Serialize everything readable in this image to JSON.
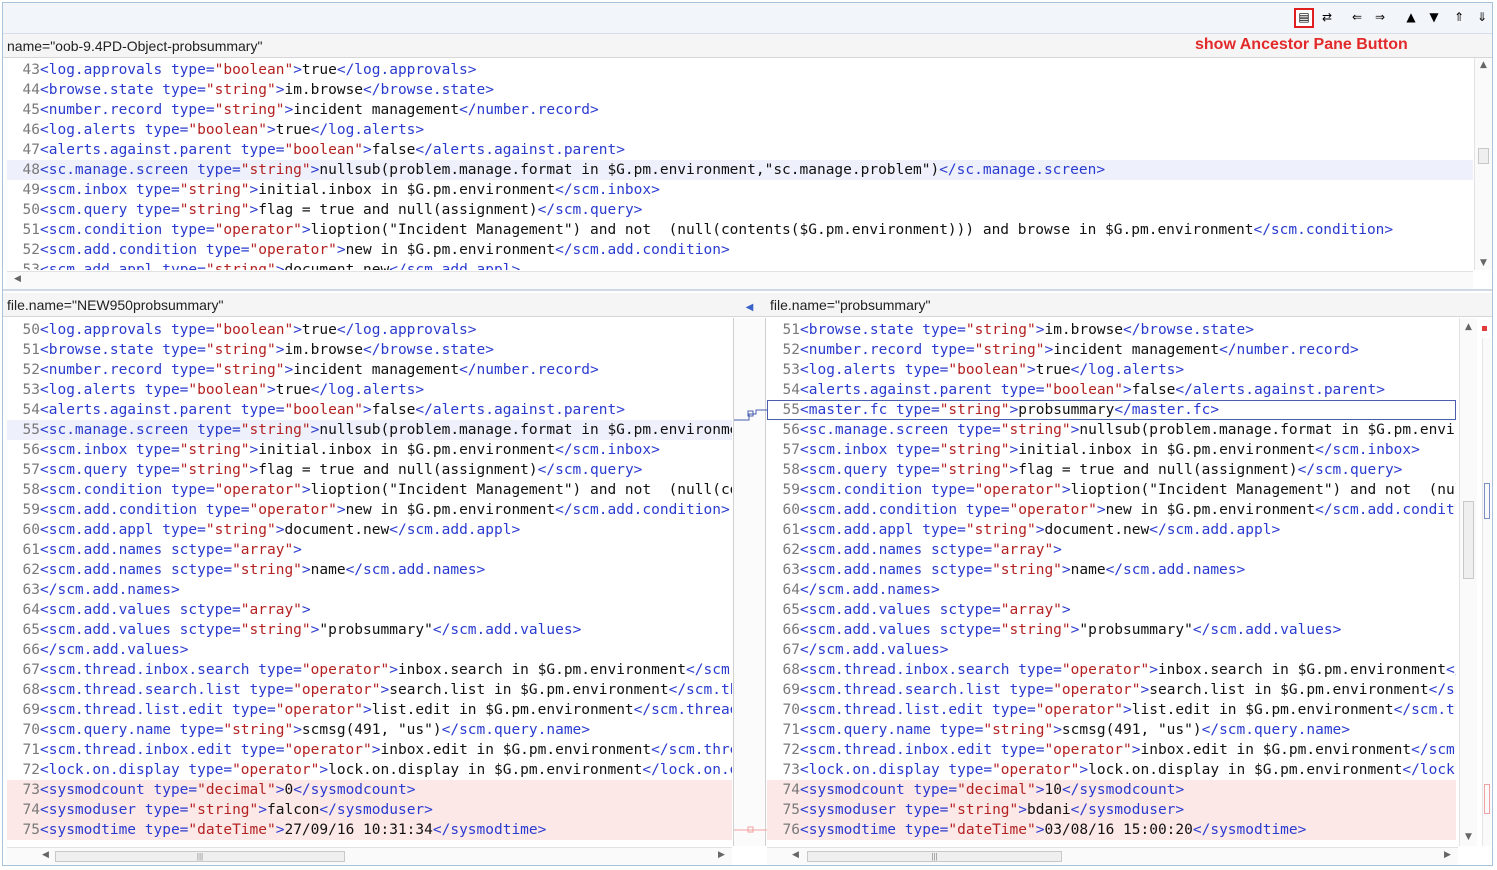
{
  "toolbar": {
    "buttons": [
      {
        "icon": "show-ancestor-pane-icon",
        "glyph": "▤"
      },
      {
        "icon": "swap-icon",
        "glyph": "⇄"
      },
      {
        "icon": "copy-left-icon",
        "glyph": "⇐"
      },
      {
        "icon": "copy-right-icon",
        "glyph": "⇒"
      },
      {
        "icon": "next-diff-icon",
        "glyph": "▲"
      },
      {
        "icon": "prev-diff-icon",
        "glyph": "▼"
      },
      {
        "icon": "next-change-icon",
        "glyph": "⇑"
      },
      {
        "icon": "prev-change-icon",
        "glyph": "⇓"
      }
    ]
  },
  "annotation": "show Ancestor Pane Button",
  "ancestor": {
    "name": "name=\"oob-9.4PD-Object-probsummary\"",
    "lines": [
      {
        "n": "43",
        "t": "<log.approvals type=\"boolean\">true</log.approvals>"
      },
      {
        "n": "44",
        "t": "<browse.state type=\"string\">im.browse</browse.state>"
      },
      {
        "n": "45",
        "t": "<number.record type=\"string\">incident management</number.record>"
      },
      {
        "n": "46",
        "t": "<log.alerts type=\"boolean\">true</log.alerts>"
      },
      {
        "n": "47",
        "t": "<alerts.against.parent type=\"boolean\">false</alerts.against.parent>"
      },
      {
        "n": "48",
        "t": "<sc.manage.screen type=\"string\">nullsub(problem.manage.format in $G.pm.environment,\"sc.manage.problem\")</sc.manage.screen>",
        "cls": "sel"
      },
      {
        "n": "49",
        "t": "<scm.inbox type=\"string\">initial.inbox in $G.pm.environment</scm.inbox>"
      },
      {
        "n": "50",
        "t": "<scm.query type=\"string\">flag = true and null(assignment)</scm.query>"
      },
      {
        "n": "51",
        "t": "<scm.condition type=\"operator\">lioption(\"Incident Management\") and not  (null(contents($G.pm.environment))) and browse in $G.pm.environment</scm.condition>"
      },
      {
        "n": "52",
        "t": "<scm.add.condition type=\"operator\">new in $G.pm.environment</scm.add.condition>"
      },
      {
        "n": "53",
        "t": "<scm.add.appl type=\"string\">document.new</scm.add.appl>"
      }
    ]
  },
  "left": {
    "name": "file.name=\"NEW950probsummary\"",
    "lines": [
      {
        "n": "50",
        "t": "<log.approvals type=\"boolean\">true</log.approvals>"
      },
      {
        "n": "51",
        "t": "<browse.state type=\"string\">im.browse</browse.state>"
      },
      {
        "n": "52",
        "t": "<number.record type=\"string\">incident management</number.record>"
      },
      {
        "n": "53",
        "t": "<log.alerts type=\"boolean\">true</log.alerts>"
      },
      {
        "n": "54",
        "t": "<alerts.against.parent type=\"boolean\">false</alerts.against.parent>"
      },
      {
        "n": "55",
        "t": "<sc.manage.screen type=\"string\">nullsub(problem.manage.format in $G.pm.environment,\"sc.manage.problem\")</sc.manage.screen>",
        "cls": "sel"
      },
      {
        "n": "56",
        "t": "<scm.inbox type=\"string\">initial.inbox in $G.pm.environment</scm.inbox>"
      },
      {
        "n": "57",
        "t": "<scm.query type=\"string\">flag = true and null(assignment)</scm.query>"
      },
      {
        "n": "58",
        "t": "<scm.condition type=\"operator\">lioption(\"Incident Management\") and not  (null(contents($G.pm.environment)))</scm.condition>"
      },
      {
        "n": "59",
        "t": "<scm.add.condition type=\"operator\">new in $G.pm.environment</scm.add.condition>"
      },
      {
        "n": "60",
        "t": "<scm.add.appl type=\"string\">document.new</scm.add.appl>"
      },
      {
        "n": "61",
        "t": "<scm.add.names sctype=\"array\">"
      },
      {
        "n": "62",
        "t": "<scm.add.names sctype=\"string\">name</scm.add.names>"
      },
      {
        "n": "63",
        "t": "</scm.add.names>"
      },
      {
        "n": "64",
        "t": "<scm.add.values sctype=\"array\">"
      },
      {
        "n": "65",
        "t": "<scm.add.values sctype=\"string\">\"probsummary\"</scm.add.values>"
      },
      {
        "n": "66",
        "t": "</scm.add.values>"
      },
      {
        "n": "67",
        "t": "<scm.thread.inbox.search type=\"operator\">inbox.search in $G.pm.environment</scm.thread.inbox.search>"
      },
      {
        "n": "68",
        "t": "<scm.thread.search.list type=\"operator\">search.list in $G.pm.environment</scm.thread.search.list>"
      },
      {
        "n": "69",
        "t": "<scm.thread.list.edit type=\"operator\">list.edit in $G.pm.environment</scm.thread.list.edit>"
      },
      {
        "n": "70",
        "t": "<scm.query.name type=\"string\">scmsg(491, \"us\")</scm.query.name>"
      },
      {
        "n": "71",
        "t": "<scm.thread.inbox.edit type=\"operator\">inbox.edit in $G.pm.environment</scm.thread.inbox.edit>"
      },
      {
        "n": "72",
        "t": "<lock.on.display type=\"operator\">lock.on.display in $G.pm.environment</lock.on.display>"
      },
      {
        "n": "73",
        "t": "<sysmodcount type=\"decimal\">0</sysmodcount>",
        "cls": "diff"
      },
      {
        "n": "74",
        "t": "<sysmoduser type=\"string\">falcon</sysmoduser>",
        "cls": "diff"
      },
      {
        "n": "75",
        "t": "<sysmodtime type=\"dateTime\">27/09/16 10:31:34</sysmodtime>",
        "cls": "diff"
      }
    ]
  },
  "right": {
    "name": "file.name=\"probsummary\"",
    "lines": [
      {
        "n": "51",
        "t": "<browse.state type=\"string\">im.browse</browse.state>"
      },
      {
        "n": "52",
        "t": "<number.record type=\"string\">incident management</number.record>"
      },
      {
        "n": "53",
        "t": "<log.alerts type=\"boolean\">true</log.alerts>"
      },
      {
        "n": "54",
        "t": "<alerts.against.parent type=\"boolean\">false</alerts.against.parent>"
      },
      {
        "n": "55",
        "t": "<master.fc type=\"string\">probsummary</master.fc>",
        "cls": "box"
      },
      {
        "n": "56",
        "t": "<sc.manage.screen type=\"string\">nullsub(problem.manage.format in $G.pm.environment,\"sc.manage.problem\")</sc.manage.screen>"
      },
      {
        "n": "57",
        "t": "<scm.inbox type=\"string\">initial.inbox in $G.pm.environment</scm.inbox>"
      },
      {
        "n": "58",
        "t": "<scm.query type=\"string\">flag = true and null(assignment)</scm.query>"
      },
      {
        "n": "59",
        "t": "<scm.condition type=\"operator\">lioption(\"Incident Management\") and not  (null(contents($G.pm.environment)))</scm.condition>"
      },
      {
        "n": "60",
        "t": "<scm.add.condition type=\"operator\">new in $G.pm.environment</scm.add.condition>"
      },
      {
        "n": "61",
        "t": "<scm.add.appl type=\"string\">document.new</scm.add.appl>"
      },
      {
        "n": "62",
        "t": "<scm.add.names sctype=\"array\">"
      },
      {
        "n": "63",
        "t": "<scm.add.names sctype=\"string\">name</scm.add.names>"
      },
      {
        "n": "64",
        "t": "</scm.add.names>"
      },
      {
        "n": "65",
        "t": "<scm.add.values sctype=\"array\">"
      },
      {
        "n": "66",
        "t": "<scm.add.values sctype=\"string\">\"probsummary\"</scm.add.values>"
      },
      {
        "n": "67",
        "t": "</scm.add.values>"
      },
      {
        "n": "68",
        "t": "<scm.thread.inbox.search type=\"operator\">inbox.search in $G.pm.environment</scm.thread.inbox.search>"
      },
      {
        "n": "69",
        "t": "<scm.thread.search.list type=\"operator\">search.list in $G.pm.environment</scm.thread.search.list>"
      },
      {
        "n": "70",
        "t": "<scm.thread.list.edit type=\"operator\">list.edit in $G.pm.environment</scm.thread.list.edit>"
      },
      {
        "n": "71",
        "t": "<scm.query.name type=\"string\">scmsg(491, \"us\")</scm.query.name>"
      },
      {
        "n": "72",
        "t": "<scm.thread.inbox.edit type=\"operator\">inbox.edit in $G.pm.environment</scm.thread.inbox.edit>"
      },
      {
        "n": "73",
        "t": "<lock.on.display type=\"operator\">lock.on.display in $G.pm.environment</lock.on.display>"
      },
      {
        "n": "74",
        "t": "<sysmodcount type=\"decimal\">10</sysmodcount>",
        "cls": "diff"
      },
      {
        "n": "75",
        "t": "<sysmoduser type=\"string\">bdani</sysmoduser>",
        "cls": "diff"
      },
      {
        "n": "76",
        "t": "<sysmodtime type=\"dateTime\">03/08/16 15:00:20</sysmodtime>",
        "cls": "diff"
      }
    ]
  },
  "scroll": {
    "ancestor_v": 0.45,
    "left_h": 0.0,
    "right_h": 0.0,
    "right_v": 0.4
  },
  "colors": {
    "tag": "#2a3bd0",
    "value": "#b42222",
    "highlight": "#e02020",
    "diff": "#fde8e8"
  }
}
